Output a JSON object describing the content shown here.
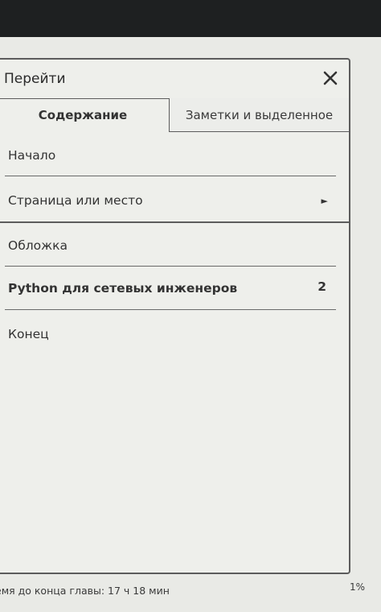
{
  "dialog": {
    "title": "Перейти"
  },
  "tabs": [
    {
      "label": "Содержание"
    },
    {
      "label": "Заметки и выделенное"
    }
  ],
  "nav": {
    "start": "Начало",
    "page_or_location": "Страница или место",
    "arrow": "►"
  },
  "toc": {
    "items": [
      {
        "label": "Обложка"
      },
      {
        "label": "Python для сетевых инженеров",
        "page": "2"
      },
      {
        "label": "Конец"
      }
    ]
  },
  "footer": {
    "time_left": "емя до конца главы: 17 ч 18 мин",
    "progress": "1%"
  }
}
